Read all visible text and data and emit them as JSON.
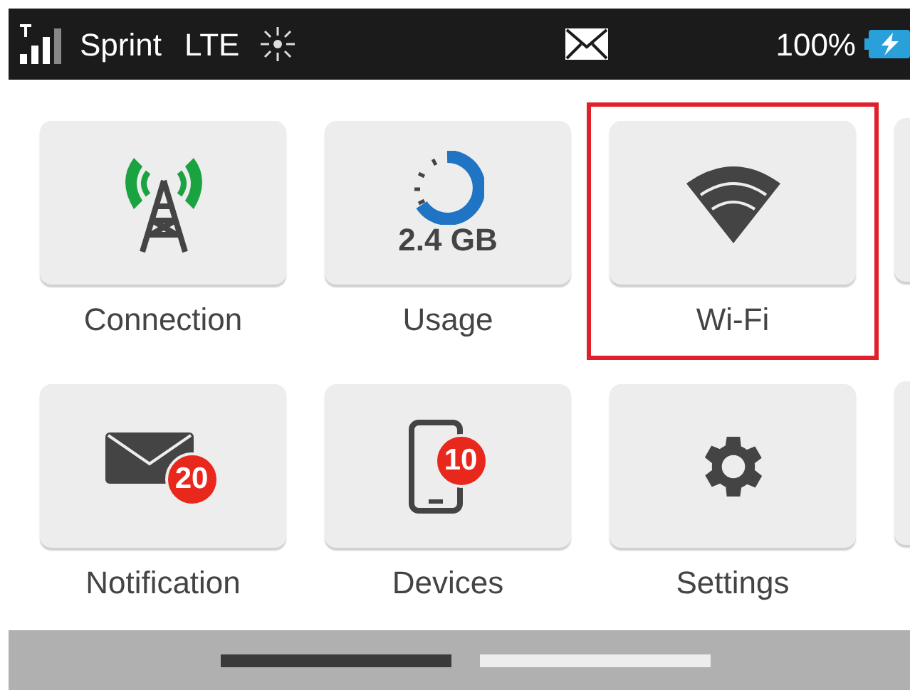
{
  "status_bar": {
    "carrier": "Sprint",
    "network": "LTE",
    "battery": "100%"
  },
  "tiles": [
    {
      "kind": "connection",
      "label": "Connection",
      "selected": false
    },
    {
      "kind": "usage",
      "label": "Usage",
      "value": "2.4 GB",
      "selected": false
    },
    {
      "kind": "wifi",
      "label": "Wi-Fi",
      "selected": true
    },
    {
      "kind": "partial"
    },
    {
      "kind": "notification",
      "label": "Notification",
      "badge": "20",
      "selected": false
    },
    {
      "kind": "devices",
      "label": "Devices",
      "badge": "10",
      "selected": false
    },
    {
      "kind": "settings",
      "label": "Settings",
      "selected": false
    },
    {
      "kind": "partial"
    }
  ],
  "pages": [
    {
      "selected": true
    },
    {
      "selected": false
    }
  ]
}
